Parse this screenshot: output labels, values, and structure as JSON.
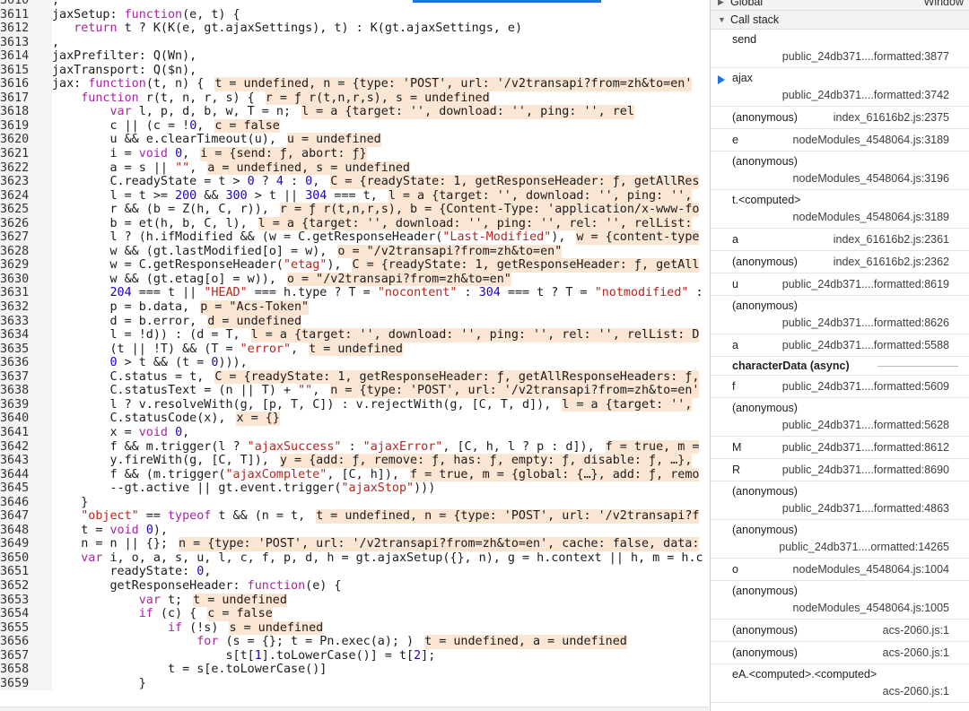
{
  "editor": {
    "lines": [
      {
        "num": "3610",
        "code": ","
      },
      {
        "num": "3611",
        "code": "jaxSetup: function(e, t) {"
      },
      {
        "num": "3612",
        "code": "   return t ? K(K(e, gt.ajaxSettings), t) : K(gt.ajaxSettings, e)"
      },
      {
        "num": "3613",
        "code": ","
      },
      {
        "num": "3614",
        "code": "jaxPrefilter: Q(Wn),"
      },
      {
        "num": "3615",
        "code": "jaxTransport: Q($n),"
      },
      {
        "num": "3616",
        "code": "jax: function(t, n) {",
        "hint": "t = undefined, n = {type: 'POST', url: '/v2transapi?from=zh&to=en'"
      },
      {
        "num": "3617",
        "code": "    function r(t, n, r, s) {",
        "hint": "r = ƒ r(t,n,r,s), s = undefined"
      },
      {
        "num": "3618",
        "code": "        var l, p, d, b, w, T = n;",
        "hint": "l = a {target: '', download: '', ping: '', rel"
      },
      {
        "num": "3619",
        "code": "        c || (c = !0,",
        "hint": "c = false"
      },
      {
        "num": "3620",
        "code": "        u && e.clearTimeout(u),",
        "hint": "u = undefined"
      },
      {
        "num": "3621",
        "code": "        i = void 0,",
        "hint": "i = {send: ƒ, abort: ƒ}"
      },
      {
        "num": "3622",
        "code": "        a = s || \"\",",
        "hint": "a = undefined, s = undefined"
      },
      {
        "num": "3623",
        "code": "        C.readyState = t > 0 ? 4 : 0,",
        "hint": "C = {readyState: 1, getResponseHeader: ƒ, getAllRes"
      },
      {
        "num": "3624",
        "code": "        l = t >= 200 && 300 > t || 304 === t,",
        "hint": "l = a {target: '', download: '', ping: '',"
      },
      {
        "num": "3625",
        "code": "        r && (b = Z(h, C, r)),",
        "hint": "r = ƒ r(t,n,r,s), b = {Content-Type: 'application/x-www-fo"
      },
      {
        "num": "3626",
        "code": "        b = et(h, b, C, l),",
        "hint": "l = a {target: '', download: '', ping: '', rel: '', relList:"
      },
      {
        "num": "3627",
        "code": "        l ? (h.ifModified && (w = C.getResponseHeader(\"Last-Modified\"),",
        "hint": "w = {content-type"
      },
      {
        "num": "3628",
        "code": "        w && (gt.lastModified[o] = w),",
        "hint": "o = \"/v2transapi?from=zh&to=en\""
      },
      {
        "num": "3629",
        "code": "        w = C.getResponseHeader(\"etag\"),",
        "hint": "C = {readyState: 1, getResponseHeader: ƒ, getAll"
      },
      {
        "num": "3630",
        "code": "        w && (gt.etag[o] = w)),",
        "hint": "o = \"/v2transapi?from=zh&to=en\""
      },
      {
        "num": "3631",
        "code": "        204 === t || \"HEAD\" === h.type ? T = \"nocontent\" : 304 === t ? T = \"notmodified\" :"
      },
      {
        "num": "3632",
        "code": "        p = b.data,",
        "hint": "p = \"Acs-Token\""
      },
      {
        "num": "3633",
        "code": "        d = b.error,",
        "hint": "d = undefined"
      },
      {
        "num": "3634",
        "code": "        l = !d)) : (d = T,",
        "hint": "l = a {target: '', download: '', ping: '', rel: '', relList: D"
      },
      {
        "num": "3635",
        "code": "        (t || !T) && (T = \"error\",",
        "hint": "t = undefined"
      },
      {
        "num": "3636",
        "code": "        0 > t && (t = 0))),"
      },
      {
        "num": "3637",
        "code": "        C.status = t,",
        "hint": "C = {readyState: 1, getResponseHeader: ƒ, getAllResponseHeaders: ƒ,"
      },
      {
        "num": "3638",
        "code": "        C.statusText = (n || T) + \"\",",
        "hint": "n = {type: 'POST', url: '/v2transapi?from=zh&to=en'"
      },
      {
        "num": "3639",
        "code": "        l ? v.resolveWith(g, [p, T, C]) : v.rejectWith(g, [C, T, d]),",
        "hint": "l = a {target: '',"
      },
      {
        "num": "3640",
        "code": "        C.statusCode(x),",
        "hint": "x = {}"
      },
      {
        "num": "3641",
        "code": "        x = void 0,"
      },
      {
        "num": "3642",
        "code": "        f && m.trigger(l ? \"ajaxSuccess\" : \"ajaxError\", [C, h, l ? p : d]),",
        "hint": "f = true, m ="
      },
      {
        "num": "3643",
        "code": "        y.fireWith(g, [C, T]),",
        "hint": "y = {add: ƒ, remove: ƒ, has: ƒ, empty: ƒ, disable: ƒ, …},"
      },
      {
        "num": "3644",
        "code": "        f && (m.trigger(\"ajaxComplete\", [C, h]),",
        "hint": "f = true, m = {global: {…}, add: ƒ, remo"
      },
      {
        "num": "3645",
        "code": "        --gt.active || gt.event.trigger(\"ajaxStop\")))"
      },
      {
        "num": "3646",
        "code": "    }"
      },
      {
        "num": "3647",
        "code": "    \"object\" == typeof t && (n = t,",
        "hint": "t = undefined, n = {type: 'POST', url: '/v2transapi?f"
      },
      {
        "num": "3648",
        "code": "    t = void 0),"
      },
      {
        "num": "3649",
        "code": "    n = n || {};",
        "hint": "n = {type: 'POST', url: '/v2transapi?from=zh&to=en', cache: false, data:"
      },
      {
        "num": "3650",
        "code": "    var i, o, a, s, u, l, c, f, p, d, h = gt.ajaxSetup({}, n), g = h.context || h, m = h.c"
      },
      {
        "num": "3651",
        "code": "        readyState: 0,"
      },
      {
        "num": "3652",
        "code": "        getResponseHeader: function(e) {"
      },
      {
        "num": "3653",
        "code": "            var t;",
        "hint": "t = undefined"
      },
      {
        "num": "3654",
        "code": "            if (c) {",
        "hint": "c = false"
      },
      {
        "num": "3655",
        "code": "                if (!s)",
        "hint": "s = undefined"
      },
      {
        "num": "3656",
        "code": "                    for (s = {}; t = Pn.exec(a); )",
        "hint": "t = undefined, a = undefined"
      },
      {
        "num": "3657",
        "code": "                        s[t[1].toLowerCase()] = t[2];"
      },
      {
        "num": "3658",
        "code": "                t = s[e.toLowerCase()]"
      },
      {
        "num": "3659",
        "code": "            }"
      }
    ]
  },
  "panel": {
    "global_row": {
      "label": "Global",
      "value": "Window"
    },
    "call_stack_title": "Call stack",
    "frames": [
      {
        "fn": "send",
        "loc": "public_24db371....formatted:3877",
        "layout": "double",
        "current": false
      },
      {
        "fn": "ajax",
        "loc": "public_24db371....formatted:3742",
        "layout": "double",
        "current": true
      },
      {
        "fn": "(anonymous)",
        "loc": "index_61616b2.js:2375",
        "layout": "single",
        "current": false
      },
      {
        "fn": "e",
        "loc": "nodeModules_4548064.js:3189",
        "layout": "single",
        "current": false
      },
      {
        "fn": "(anonymous)",
        "loc": "nodeModules_4548064.js:3196",
        "layout": "double",
        "current": false
      },
      {
        "fn": "t.<computed>",
        "loc": "nodeModules_4548064.js:3189",
        "layout": "double",
        "current": false
      },
      {
        "fn": "a",
        "loc": "index_61616b2.js:2361",
        "layout": "single",
        "current": false
      },
      {
        "fn": "(anonymous)",
        "loc": "index_61616b2.js:2362",
        "layout": "single",
        "current": false
      },
      {
        "fn": "u",
        "loc": "public_24db371....formatted:8619",
        "layout": "single",
        "current": false
      },
      {
        "fn": "(anonymous)",
        "loc": "public_24db371....formatted:8626",
        "layout": "double",
        "current": false
      },
      {
        "fn": "a",
        "loc": "public_24db371....formatted:5588",
        "layout": "single",
        "current": false
      },
      {
        "fn": "characterData (async)",
        "loc": "",
        "layout": "async",
        "current": false
      },
      {
        "fn": "f",
        "loc": "public_24db371....formatted:5609",
        "layout": "single",
        "current": false
      },
      {
        "fn": "(anonymous)",
        "loc": "public_24db371....formatted:5628",
        "layout": "double",
        "current": false
      },
      {
        "fn": "M",
        "loc": "public_24db371....formatted:8612",
        "layout": "single",
        "current": false
      },
      {
        "fn": "R",
        "loc": "public_24db371....formatted:8690",
        "layout": "single",
        "current": false
      },
      {
        "fn": "(anonymous)",
        "loc": "public_24db371....formatted:4863",
        "layout": "double",
        "current": false
      },
      {
        "fn": "(anonymous)",
        "loc": "public_24db371....ormatted:14265",
        "layout": "double",
        "current": false
      },
      {
        "fn": "o",
        "loc": "nodeModules_4548064.js:1004",
        "layout": "single",
        "current": false
      },
      {
        "fn": "(anonymous)",
        "loc": "nodeModules_4548064.js:1005",
        "layout": "double",
        "current": false
      },
      {
        "fn": "(anonymous)",
        "loc": "acs-2060.js:1",
        "layout": "single",
        "current": false
      },
      {
        "fn": "(anonymous)",
        "loc": "acs-2060.js:1",
        "layout": "single",
        "current": false
      },
      {
        "fn": "eA.<computed>.<computed>",
        "loc": "acs-2060.js:1",
        "layout": "double",
        "current": false
      }
    ]
  }
}
